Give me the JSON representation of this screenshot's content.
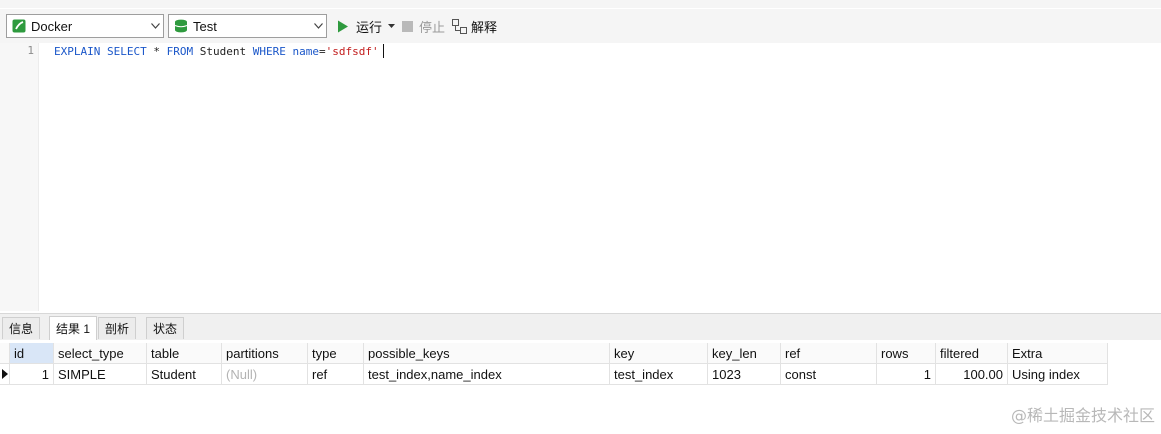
{
  "toolbar": {
    "connection": {
      "value": "Docker",
      "icon": "connection-icon",
      "color": "#2e9a3e"
    },
    "database": {
      "value": "Test",
      "icon": "database-icon",
      "color": "#2e9a3e"
    },
    "run_label": "运行",
    "stop_label": "停止",
    "explain_label": "解释"
  },
  "editor": {
    "line_number": "1",
    "tokens": {
      "explain": "EXPLAIN",
      "select": "SELECT",
      "star": "*",
      "from": "FROM",
      "table": "Student",
      "where": "WHERE",
      "column": "name",
      "equals": "=",
      "value": "'sdfsdf'"
    }
  },
  "result_tabs": [
    "信息",
    "结果 1",
    "剖析",
    "状态"
  ],
  "active_tab": "结果 1",
  "grid": {
    "columns": [
      "id",
      "select_type",
      "table",
      "partitions",
      "type",
      "possible_keys",
      "key",
      "key_len",
      "ref",
      "rows",
      "filtered",
      "Extra"
    ],
    "row": {
      "id": "1",
      "select_type": "SIMPLE",
      "table": "Student",
      "partitions": "(Null)",
      "type": "ref",
      "possible_keys": "test_index,name_index",
      "key": "test_index",
      "key_len": "1023",
      "ref": "const",
      "rows": "1",
      "filtered": "100.00",
      "Extra": "Using index"
    }
  },
  "watermark": "@稀土掘金技术社区",
  "colors": {
    "keyword": "#1b57c9",
    "string": "#c21b1b",
    "run_green": "#2e9a3e"
  }
}
